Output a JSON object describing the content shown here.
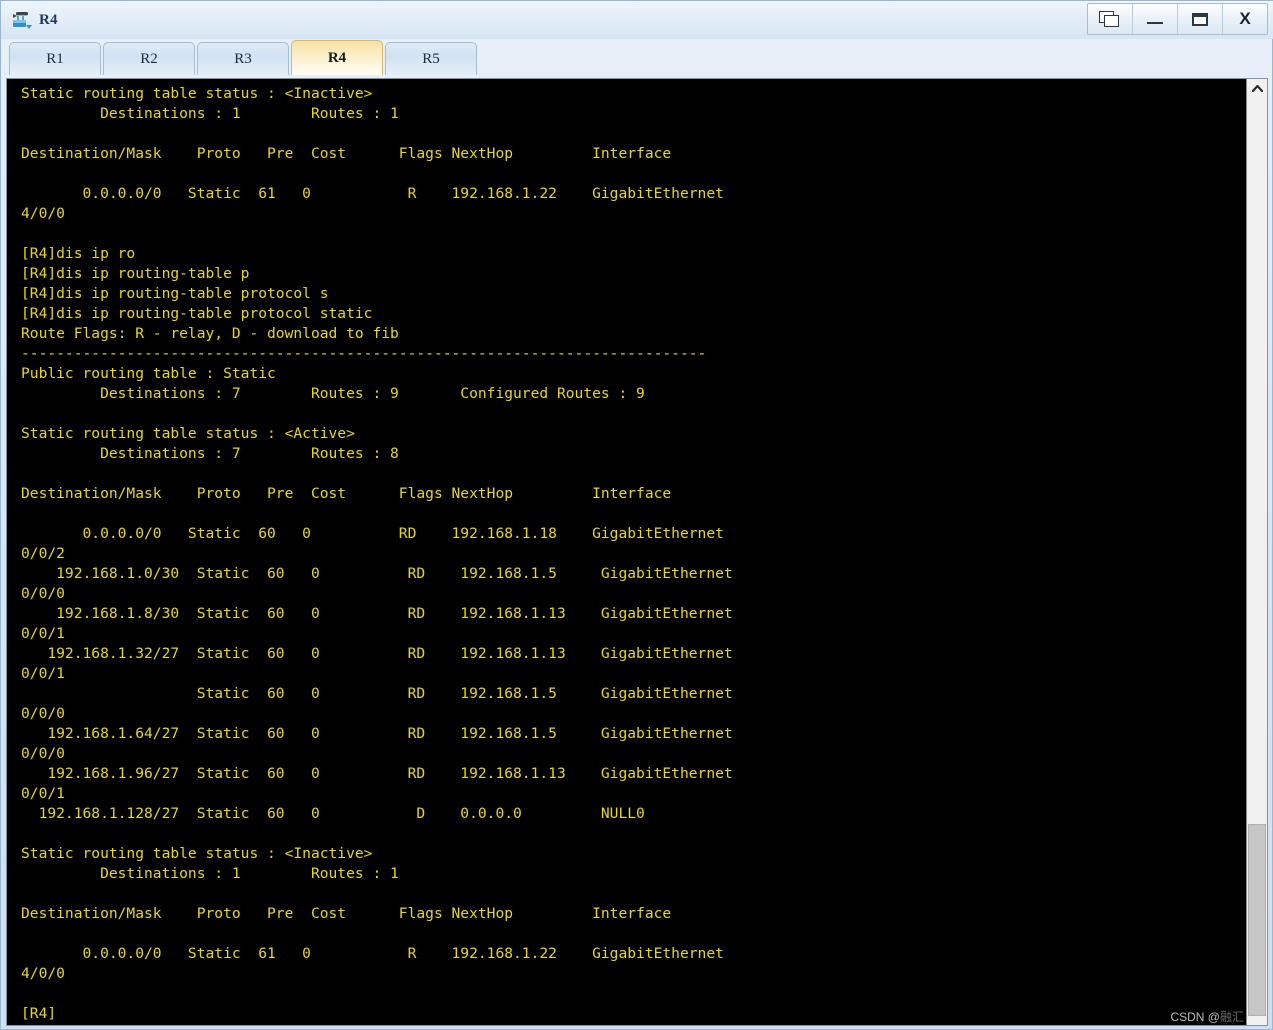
{
  "window": {
    "title": "R4",
    "icon": "router-icon",
    "controls": [
      {
        "name": "restore-button",
        "label": ""
      },
      {
        "name": "minimize-button",
        "label": ""
      },
      {
        "name": "maximize-button",
        "label": ""
      },
      {
        "name": "close-button",
        "label": "X"
      }
    ]
  },
  "tabs": [
    {
      "label": "R1",
      "active": false
    },
    {
      "label": "R2",
      "active": false
    },
    {
      "label": "R3",
      "active": false
    },
    {
      "label": "R4",
      "active": true
    },
    {
      "label": "R5",
      "active": false
    }
  ],
  "terminal": {
    "foreground": "#e8d81c",
    "background": "#000000",
    "content": "Static routing table status : <Inactive>\n         Destinations : 1        Routes : 1\n\nDestination/Mask    Proto   Pre  Cost      Flags NextHop         Interface\n\n       0.0.0.0/0   Static  61   0           R    192.168.1.22    GigabitEthernet\n4/0/0\n\n[R4]dis ip ro\n[R4]dis ip routing-table p\n[R4]dis ip routing-table protocol s\n[R4]dis ip routing-table protocol static\nRoute Flags: R - relay, D - download to fib\n------------------------------------------------------------------------------\nPublic routing table : Static\n         Destinations : 7        Routes : 9       Configured Routes : 9\n\nStatic routing table status : <Active>\n         Destinations : 7        Routes : 8\n\nDestination/Mask    Proto   Pre  Cost      Flags NextHop         Interface\n\n       0.0.0.0/0   Static  60   0          RD    192.168.1.18    GigabitEthernet\n0/0/2\n    192.168.1.0/30  Static  60   0          RD    192.168.1.5     GigabitEthernet\n0/0/0\n    192.168.1.8/30  Static  60   0          RD    192.168.1.13    GigabitEthernet\n0/0/1\n   192.168.1.32/27  Static  60   0          RD    192.168.1.13    GigabitEthernet\n0/0/1\n                    Static  60   0          RD    192.168.1.5     GigabitEthernet\n0/0/0\n   192.168.1.64/27  Static  60   0          RD    192.168.1.5     GigabitEthernet\n0/0/0\n   192.168.1.96/27  Static  60   0          RD    192.168.1.13    GigabitEthernet\n0/0/1\n  192.168.1.128/27  Static  60   0           D    0.0.0.0         NULL0\n\nStatic routing table status : <Inactive>\n         Destinations : 1        Routes : 1\n\nDestination/Mask    Proto   Pre  Cost      Flags NextHop         Interface\n\n       0.0.0.0/0   Static  61   0           R    192.168.1.22    GigabitEthernet\n4/0/0\n\n[R4]",
    "prompt": "[R4]",
    "columns": [
      "Destination/Mask",
      "Proto",
      "Pre",
      "Cost",
      "Flags",
      "NextHop",
      "Interface"
    ],
    "commands": [
      "dis ip ro",
      "dis ip routing-table p",
      "dis ip routing-table protocol s",
      "dis ip routing-table protocol static"
    ],
    "route_flags_legend": "Route Flags: R - relay, D - download to fib",
    "public_table": {
      "name": "Public routing table : Static",
      "destinations": "7",
      "routes": "9",
      "configured_routes": "9"
    },
    "active_table": {
      "status": "<Active>",
      "destinations": "7",
      "routes": "8",
      "rows": [
        {
          "destination": "0.0.0.0/0",
          "proto": "Static",
          "pre": "60",
          "cost": "0",
          "flags": "RD",
          "nexthop": "192.168.1.18",
          "interface": "GigabitEthernet0/0/2"
        },
        {
          "destination": "192.168.1.0/30",
          "proto": "Static",
          "pre": "60",
          "cost": "0",
          "flags": "RD",
          "nexthop": "192.168.1.5",
          "interface": "GigabitEthernet0/0/0"
        },
        {
          "destination": "192.168.1.8/30",
          "proto": "Static",
          "pre": "60",
          "cost": "0",
          "flags": "RD",
          "nexthop": "192.168.1.13",
          "interface": "GigabitEthernet0/0/1"
        },
        {
          "destination": "192.168.1.32/27",
          "proto": "Static",
          "pre": "60",
          "cost": "0",
          "flags": "RD",
          "nexthop": "192.168.1.13",
          "interface": "GigabitEthernet0/0/1"
        },
        {
          "destination": "",
          "proto": "Static",
          "pre": "60",
          "cost": "0",
          "flags": "RD",
          "nexthop": "192.168.1.5",
          "interface": "GigabitEthernet0/0/0"
        },
        {
          "destination": "192.168.1.64/27",
          "proto": "Static",
          "pre": "60",
          "cost": "0",
          "flags": "RD",
          "nexthop": "192.168.1.5",
          "interface": "GigabitEthernet0/0/0"
        },
        {
          "destination": "192.168.1.96/27",
          "proto": "Static",
          "pre": "60",
          "cost": "0",
          "flags": "RD",
          "nexthop": "192.168.1.13",
          "interface": "GigabitEthernet0/0/1"
        },
        {
          "destination": "192.168.1.128/27",
          "proto": "Static",
          "pre": "60",
          "cost": "0",
          "flags": "D",
          "nexthop": "0.0.0.0",
          "interface": "NULL0"
        }
      ]
    },
    "inactive_tables": [
      {
        "status": "<Inactive>",
        "destinations": "1",
        "routes": "1",
        "rows": [
          {
            "destination": "0.0.0.0/0",
            "proto": "Static",
            "pre": "61",
            "cost": "0",
            "flags": "R",
            "nexthop": "192.168.1.22",
            "interface": "GigabitEthernet4/0/0"
          }
        ]
      },
      {
        "status": "<Inactive>",
        "destinations": "1",
        "routes": "1",
        "rows": [
          {
            "destination": "0.0.0.0/0",
            "proto": "Static",
            "pre": "61",
            "cost": "0",
            "flags": "R",
            "nexthop": "192.168.1.22",
            "interface": "GigabitEthernet4/0/0"
          }
        ]
      }
    ]
  },
  "scrollbar": {
    "up_arrow": "chevron-up-icon"
  },
  "watermark": {
    "prefix": "CSDN @",
    "handle": "融汇"
  }
}
